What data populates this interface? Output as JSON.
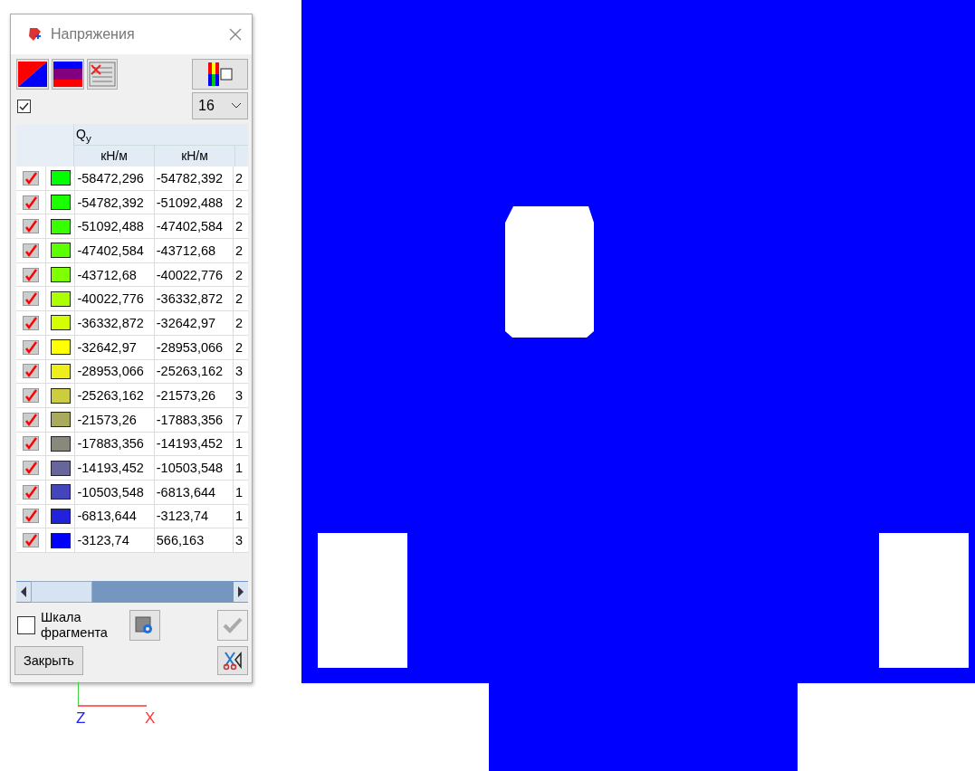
{
  "window": {
    "title": "Напряжения"
  },
  "show_checkbox": {
    "checked": true
  },
  "levels_dropdown": {
    "value": "16"
  },
  "table": {
    "group_header": "Q$_{y}$",
    "units": [
      "кН/м",
      "кН/м"
    ],
    "rows": [
      {
        "visible": true,
        "color": "#00ff00",
        "from": "-58472,296",
        "to": "-54782,392",
        "column_3": "2"
      },
      {
        "visible": true,
        "color": "#1cff00",
        "from": "-54782,392",
        "to": "-51092,488",
        "column_3": "2"
      },
      {
        "visible": true,
        "color": "#38ff00",
        "from": "-51092,488",
        "to": "-47402,584",
        "column_3": "2"
      },
      {
        "visible": true,
        "color": "#5cff00",
        "from": "-47402,584",
        "to": "-43712,68",
        "column_3": "2"
      },
      {
        "visible": true,
        "color": "#80ff00",
        "from": "-43712,68",
        "to": "-40022,776",
        "column_3": "2"
      },
      {
        "visible": true,
        "color": "#aaff00",
        "from": "-40022,776",
        "to": "-36332,872",
        "column_3": "2"
      },
      {
        "visible": true,
        "color": "#d4ff00",
        "from": "-36332,872",
        "to": "-32642,97",
        "column_3": "2"
      },
      {
        "visible": true,
        "color": "#ffff00",
        "from": "-32642,97",
        "to": "-28953,066",
        "column_3": "2"
      },
      {
        "visible": true,
        "color": "#eeee1c",
        "from": "-28953,066",
        "to": "-25263,162",
        "column_3": "3"
      },
      {
        "visible": true,
        "color": "#cccc40",
        "from": "-25263,162",
        "to": "-21573,26",
        "column_3": "3"
      },
      {
        "visible": true,
        "color": "#aaaa5e",
        "from": "-21573,26",
        "to": "-17883,356",
        "column_3": "7"
      },
      {
        "visible": true,
        "color": "#88887c",
        "from": "-17883,356",
        "to": "-14193,452",
        "column_3": "1"
      },
      {
        "visible": true,
        "color": "#66669a",
        "from": "-14193,452",
        "to": "-10503,548",
        "column_3": "1"
      },
      {
        "visible": true,
        "color": "#4444bb",
        "from": "-10503,548",
        "to": "-6813,644",
        "column_3": "1"
      },
      {
        "visible": true,
        "color": "#2222dd",
        "from": "-6813,644",
        "to": "-3123,74",
        "column_3": "1"
      },
      {
        "visible": true,
        "color": "#0000ff",
        "from": "-3123,74",
        "to": "566,163",
        "column_3": "3"
      }
    ]
  },
  "fragment_scale": {
    "label": "Шкала фрагмента",
    "checked": false
  },
  "close_button": "Закрыть",
  "axes": {
    "x": "X",
    "z": "Z"
  }
}
